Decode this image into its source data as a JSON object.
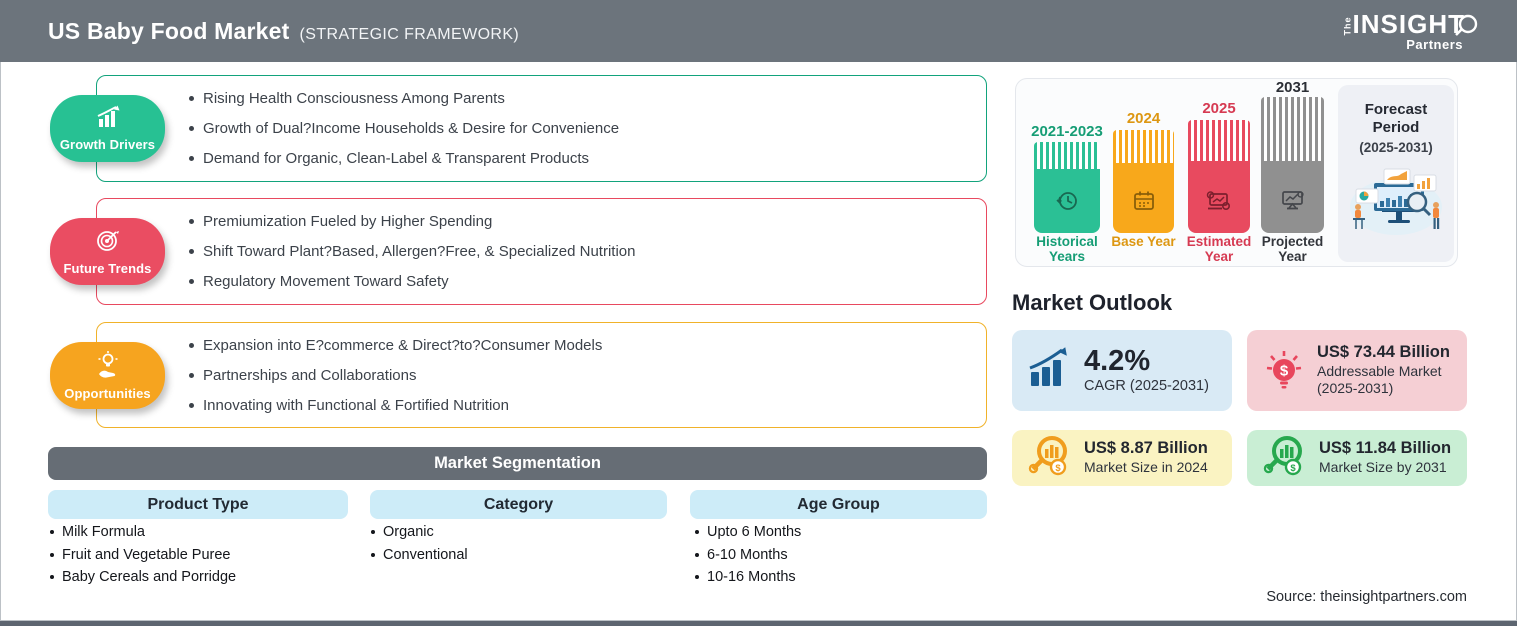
{
  "header": {
    "title": "US Baby Food Market",
    "subtitle": "(STRATEGIC FRAMEWORK)",
    "logo": {
      "the": "The",
      "insight": "INSIGHT",
      "partners": "Partners"
    }
  },
  "framework_boxes": [
    {
      "label": "Growth Drivers",
      "badge_color": "#27c193",
      "border_color": "#12a37c",
      "icon": "bar-chart-growth-icon",
      "bullets": [
        "Rising Health Consciousness Among Parents",
        "Growth of Dual?Income Households & Desire for Convenience",
        "Demand for Organic, Clean-Label & Transparent Products"
      ]
    },
    {
      "label": "Future Trends",
      "badge_color": "#ea4d62",
      "border_color": "#e8495f",
      "icon": "target-dart-icon",
      "bullets": [
        "Premiumization Fueled by Higher Spending",
        "Shift Toward Plant?Based, Allergen?Free, & Specialized Nutrition",
        "Regulatory Movement Toward Safety"
      ]
    },
    {
      "label": "Opportunities",
      "badge_color": "#f6a41f",
      "border_color": "#f0b22a",
      "icon": "bulb-hand-icon",
      "bullets": [
        "Expansion into E?commerce & Direct?to?Consumer Models",
        "Partnerships and Collaborations",
        "Innovating with Functional & Fortified Nutrition"
      ]
    }
  ],
  "timeline": {
    "bars": [
      {
        "year": "2021-2023",
        "caption": "Historical Years",
        "color": "#2bc095",
        "text_color": "#169d75",
        "icon": "history-clock-icon"
      },
      {
        "year": "2024",
        "caption": "Base Year",
        "color": "#f8a81b",
        "text_color": "#dd9712",
        "icon": "calendar-icon"
      },
      {
        "year": "2025",
        "caption": "Estimated Year",
        "color": "#e84a5f",
        "text_color": "#d63a52",
        "icon": "estimate-laptop-icon"
      },
      {
        "year": "2031",
        "caption": "Projected Year",
        "color": "#909090",
        "text_color": "#33363c",
        "icon": "projection-screen-icon"
      }
    ],
    "forecast": {
      "title": "Forecast Period",
      "subtitle": "(2025-2031)"
    }
  },
  "market_outlook": {
    "title": "Market Outlook",
    "cards": [
      {
        "value": "4.2%",
        "label": "CAGR (2025-2031)",
        "bg": "#d9eaf5",
        "icon": "growth-chart-icon"
      },
      {
        "value": "US$ 73.44 Billion",
        "label": "Addressable Market",
        "sublabel": "(2025-2031)",
        "bg": "#f5cfd4",
        "icon": "bulb-dollar-icon"
      },
      {
        "value": "US$ 8.87 Billion",
        "label": "Market Size in 2024",
        "bg": "#faf3c2",
        "icon": "magnifier-chart-orange-icon"
      },
      {
        "value": "US$ 11.84 Billion",
        "label": "Market Size by 2031",
        "bg": "#c9eed4",
        "icon": "magnifier-chart-green-icon"
      }
    ]
  },
  "segmentation": {
    "title": "Market Segmentation",
    "columns": [
      {
        "header": "Product Type",
        "items": [
          "Milk Formula",
          "Fruit and Vegetable Puree",
          "Baby Cereals and Porridge"
        ]
      },
      {
        "header": "Category",
        "items": [
          "Organic",
          "Conventional"
        ]
      },
      {
        "header": "Age Group",
        "items": [
          "Upto 6 Months",
          "6-10 Months",
          "10-16 Months"
        ]
      }
    ]
  },
  "source": "Source: theinsightpartners.com"
}
